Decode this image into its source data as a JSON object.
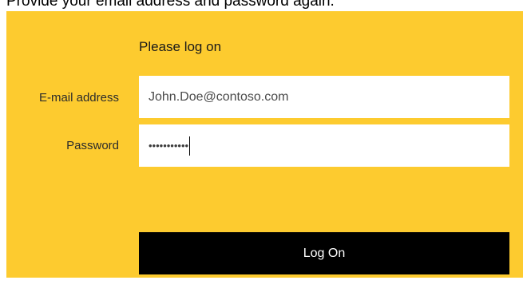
{
  "instruction": "Provide your email address and password again.",
  "form": {
    "title": "Please log on",
    "email_label": "E-mail address",
    "email_value": "John.Doe@contoso.com",
    "password_label": "Password",
    "password_masked": "•••••••••••",
    "logon_label": "Log On"
  },
  "colors": {
    "panel_background": "#fdcb2f",
    "button_background": "#000000",
    "button_text": "#ffffff"
  }
}
